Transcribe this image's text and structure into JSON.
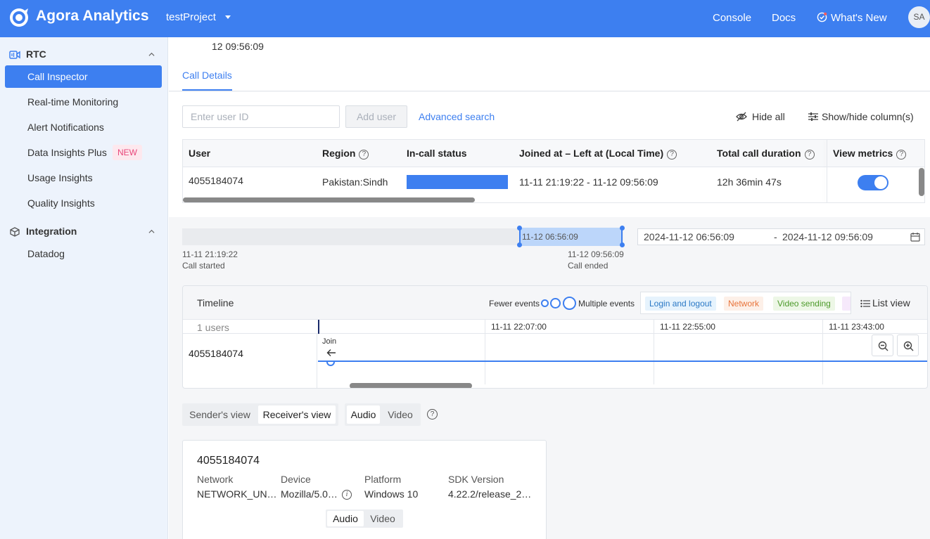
{
  "header": {
    "brand": "Agora Analytics",
    "project": "testProject",
    "nav": [
      "Console",
      "Docs",
      "What's New"
    ],
    "avatar_initials": "SA",
    "brand_color": "#3d7ff0"
  },
  "sidebar": {
    "sections": [
      {
        "label": "RTC",
        "items": [
          {
            "label": "Call Inspector",
            "active": true
          },
          {
            "label": "Real-time Monitoring"
          },
          {
            "label": "Alert Notifications"
          },
          {
            "label": "Data Insights Plus",
            "badge": "NEW"
          },
          {
            "label": "Usage Insights"
          },
          {
            "label": "Quality Insights"
          }
        ]
      },
      {
        "label": "Integration",
        "items": [
          {
            "label": "Datadog"
          }
        ]
      }
    ]
  },
  "top": {
    "prev_time": "12 09:56:09",
    "tab": "Call Details"
  },
  "toolbar": {
    "user_id_placeholder": "Enter user ID",
    "add_user": "Add user",
    "advanced_search": "Advanced search",
    "hide_all": "Hide all",
    "show_hide": "Show/hide column(s)"
  },
  "table": {
    "headers": [
      "User",
      "Region",
      "In-call status",
      "Joined at – Left at (Local Time)",
      "Total call duration",
      "View metrics"
    ],
    "row": {
      "user": "4055184074",
      "region": "Pakistan:Sindh",
      "joined_left": "11-11 21:19:22 - 11-12 09:56:09",
      "duration": "12h 36min 47s",
      "view_metrics": true
    }
  },
  "range": {
    "selection_label": "11-12 06:56:09",
    "start_time": "11-11 21:19:22",
    "start_label": "Call started",
    "end_time": "11-12 09:56:09",
    "end_label": "Call ended",
    "date_from": "2024-11-12 06:56:09",
    "date_sep": "-",
    "date_to": "2024-11-12 09:56:09"
  },
  "timeline": {
    "title": "Timeline",
    "fewer": "Fewer events",
    "multiple": "Multiple events",
    "legend": [
      {
        "label": "Login and logout",
        "bg": "#e6f3fd",
        "fg": "#2a78c5"
      },
      {
        "label": "Network",
        "bg": "#fdf0e8",
        "fg": "#e8733a"
      },
      {
        "label": "Video sending",
        "bg": "#edf7e6",
        "fg": "#4c9a2a"
      }
    ],
    "list_view": "List view",
    "users_count": "1 users",
    "ticks": [
      "11-11 22:07:00",
      "11-11 22:55:00",
      "11-11 23:43:00"
    ],
    "user": "4055184074",
    "join": "Join"
  },
  "views": {
    "perspective": [
      "Sender's view",
      "Receiver's view"
    ],
    "media": [
      "Audio",
      "Video"
    ]
  },
  "info": {
    "uid": "4055184074",
    "network_h": "Network",
    "network_v": "NETWORK_UN…",
    "device_h": "Device",
    "device_v": "Mozilla/5.0…",
    "platform_h": "Platform",
    "platform_v": "Windows 10",
    "sdk_h": "SDK Version",
    "sdk_v": "4.22.2/release_2…",
    "media": [
      "Audio",
      "Video"
    ]
  }
}
